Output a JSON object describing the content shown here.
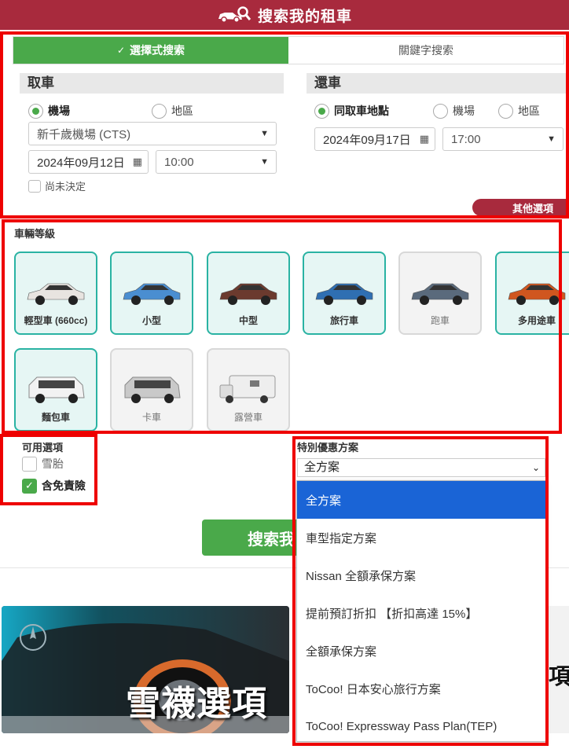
{
  "header": {
    "title": "搜索我的租車"
  },
  "tabs": [
    {
      "label": "選擇式搜索",
      "active": true
    },
    {
      "label": "關鍵字搜索",
      "active": false
    }
  ],
  "pickup": {
    "heading": "取車",
    "radio_airport": "機場",
    "radio_area": "地區",
    "location": "新千歲機場 (CTS)",
    "date": "2024年09月12日",
    "time": "10:00",
    "undecided": "尚未決定"
  },
  "return": {
    "heading": "還車",
    "radio_same": "同取車地點",
    "radio_airport": "機場",
    "radio_area": "地區",
    "date": "2024年09月17日",
    "time": "17:00"
  },
  "more_options": "其他選項",
  "vehicle_class": {
    "title": "車輛等級",
    "items": [
      {
        "label": "輕型車 (660cc)",
        "available": true
      },
      {
        "label": "小型",
        "available": true
      },
      {
        "label": "中型",
        "available": true
      },
      {
        "label": "旅行車",
        "available": true
      },
      {
        "label": "跑車",
        "available": false
      },
      {
        "label": "多用途車",
        "available": true
      },
      {
        "label": "麵包車",
        "available": true
      },
      {
        "label": "卡車",
        "available": false
      },
      {
        "label": "露營車",
        "available": false
      }
    ]
  },
  "options": {
    "title": "可用選項",
    "snow_tires": "雪胎",
    "insurance": "含免責險"
  },
  "plans": {
    "title": "特別優惠方案",
    "selected": "全方案",
    "items": [
      "全方案",
      "車型指定方案",
      "Nissan 全額承保方案",
      "提前預訂折扣 【折扣高達 15%】",
      "全額承保方案",
      "ToCoo! 日本安心旅行方案",
      "ToCoo! Expressway Pass Plan(TEP)"
    ]
  },
  "search_button": "搜索我",
  "banner": {
    "text": "雪襪選項",
    "text2": "項"
  },
  "colors": {
    "brand": "#a82a3d",
    "green": "#4aa94a",
    "teal": "#2ab3a3",
    "select_blue": "#1a64d6",
    "highlight": "#ee0000"
  }
}
